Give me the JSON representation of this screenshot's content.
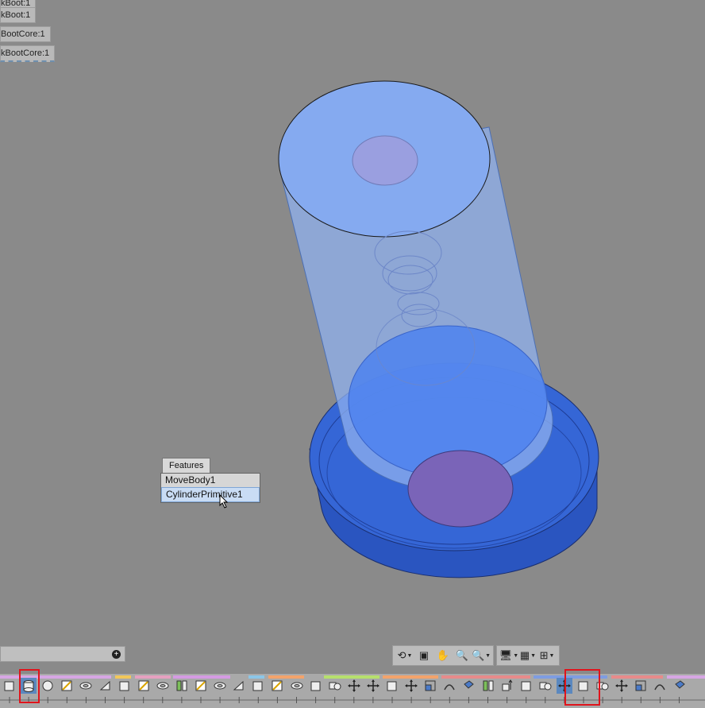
{
  "browser_tags": [
    "kBoot:1",
    "BootCore:1",
    "kBootCore:1"
  ],
  "features_popup": {
    "tab_label": "Features",
    "items": [
      "MoveBody1",
      "CylinderPrimitive1"
    ],
    "selected_index": 1
  },
  "search_bar": {
    "value": ""
  },
  "view_toolbar": [
    {
      "icon": "orbit-icon",
      "glyph": "⟲"
    },
    {
      "icon": "look-at-icon",
      "glyph": "▣"
    },
    {
      "icon": "pan-hand-icon",
      "glyph": "✋"
    },
    {
      "icon": "zoom-window-icon",
      "glyph": "🔍"
    },
    {
      "icon": "zoom-fit-icon",
      "glyph": "🔍"
    },
    {
      "icon": "display-settings-icon",
      "glyph": "🖥"
    },
    {
      "icon": "grid-settings-icon",
      "glyph": "▦"
    },
    {
      "icon": "viewports-icon",
      "glyph": "⊞"
    }
  ],
  "ribbon": {
    "accent_colors": [
      "#d7a6e4",
      "#f2c75a",
      "#e6a0c0",
      "#d59be3",
      "#8cc6e8",
      "#f3a36b",
      "#b6e06d",
      "#f3a36b",
      "#e88b8b",
      "#7e9de2",
      "#e88b8b"
    ],
    "highlight_color": "#e0141c",
    "active_button_color": "#5b88bf",
    "buttons": [
      "box-icon",
      "cylinder-icon",
      "sphere-icon",
      "sketch-icon",
      "torus-icon",
      "wedge-icon",
      "box-icon",
      "sketch-icon",
      "torus-icon",
      "split-icon",
      "sketch-icon",
      "torus-icon",
      "wedge-icon",
      "box-icon",
      "sketch-icon",
      "torus-icon",
      "box-icon",
      "combine-icon",
      "move-icon",
      "move-icon",
      "box-icon",
      "move-icon",
      "scale-icon",
      "loft-icon",
      "shell-icon",
      "split-icon",
      "extend-icon",
      "box-icon",
      "combine-icon",
      "move-icon",
      "box-icon",
      "combine-icon",
      "move-icon",
      "scale-icon",
      "loft-icon",
      "shell-icon"
    ],
    "active_buttons": [
      1,
      29
    ]
  }
}
